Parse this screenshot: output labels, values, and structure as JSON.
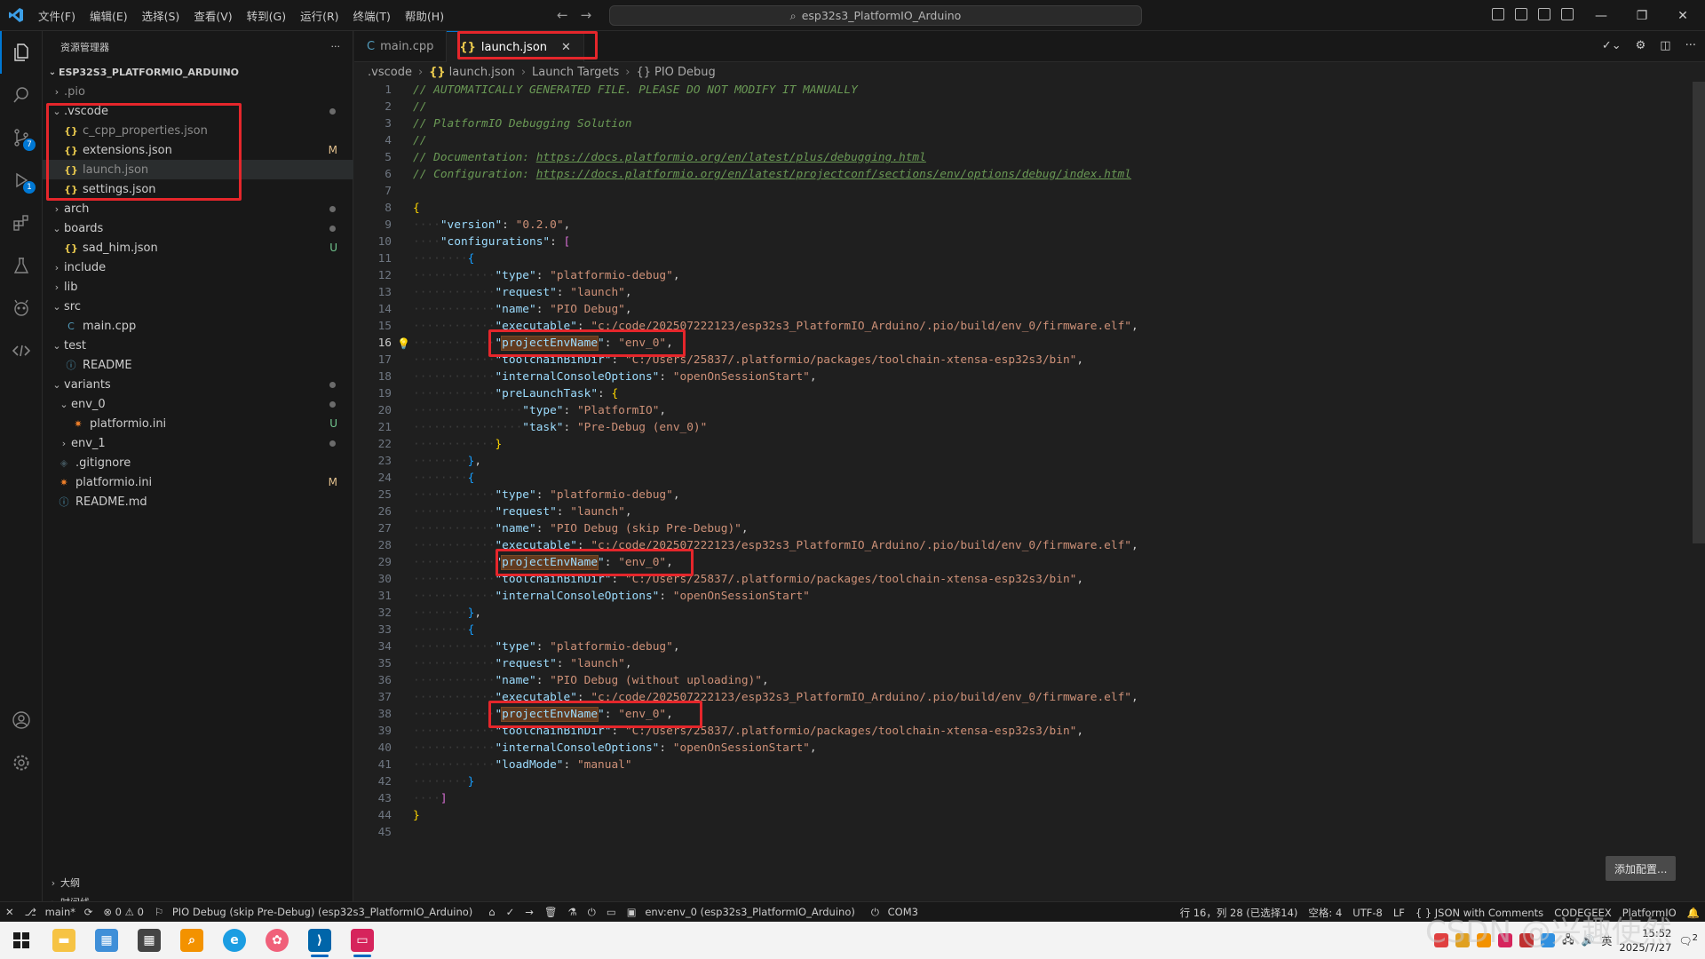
{
  "titlebar": {
    "menu": [
      "文件(F)",
      "编辑(E)",
      "选择(S)",
      "查看(V)",
      "转到(G)",
      "运行(R)",
      "终端(T)",
      "帮助(H)"
    ],
    "search": "esp32s3_PlatformIO_Arduino"
  },
  "activitybar": {
    "scm_badge": "7",
    "debug_badge": "1"
  },
  "sidebar": {
    "title": "资源管理器",
    "project": "ESP32S3_PLATFORMIO_ARDUINO",
    "tree": [
      {
        "label": ".pio",
        "depth": 0,
        "kind": "folder",
        "open": false,
        "dim": true,
        "status": ""
      },
      {
        "label": ".vscode",
        "depth": 0,
        "kind": "folder",
        "open": true,
        "dim": false,
        "status": "dot"
      },
      {
        "label": "c_cpp_properties.json",
        "depth": 1,
        "kind": "json",
        "dim": true,
        "status": ""
      },
      {
        "label": "extensions.json",
        "depth": 1,
        "kind": "json",
        "dim": false,
        "status": "M"
      },
      {
        "label": "launch.json",
        "depth": 1,
        "kind": "json",
        "dim": true,
        "status": "",
        "selected": true
      },
      {
        "label": "settings.json",
        "depth": 1,
        "kind": "json",
        "dim": false,
        "status": ""
      },
      {
        "label": "arch",
        "depth": 0,
        "kind": "folder",
        "open": false,
        "dim": false,
        "status": "dot"
      },
      {
        "label": "boards",
        "depth": 0,
        "kind": "folder",
        "open": true,
        "dim": false,
        "status": "dot"
      },
      {
        "label": "sad_him.json",
        "depth": 1,
        "kind": "json",
        "dim": false,
        "status": "U"
      },
      {
        "label": "include",
        "depth": 0,
        "kind": "folder",
        "open": false,
        "dim": false,
        "status": ""
      },
      {
        "label": "lib",
        "depth": 0,
        "kind": "folder",
        "open": false,
        "dim": false,
        "status": ""
      },
      {
        "label": "src",
        "depth": 0,
        "kind": "folder",
        "open": true,
        "dim": false,
        "status": ""
      },
      {
        "label": "main.cpp",
        "depth": 1,
        "kind": "cpp",
        "dim": false,
        "status": ""
      },
      {
        "label": "test",
        "depth": 0,
        "kind": "folder",
        "open": true,
        "dim": false,
        "status": ""
      },
      {
        "label": "README",
        "depth": 1,
        "kind": "info",
        "dim": false,
        "status": ""
      },
      {
        "label": "variants",
        "depth": 0,
        "kind": "folder",
        "open": true,
        "dim": false,
        "status": "dot"
      },
      {
        "label": "env_0",
        "depth": 1,
        "kind": "folder",
        "open": true,
        "dim": false,
        "status": "dot"
      },
      {
        "label": "platformio.ini",
        "depth": 2,
        "kind": "pio",
        "dim": false,
        "status": "U"
      },
      {
        "label": "env_1",
        "depth": 1,
        "kind": "folder",
        "open": false,
        "dim": false,
        "status": "dot"
      },
      {
        "label": ".gitignore",
        "depth": 0,
        "kind": "git",
        "dim": false,
        "status": ""
      },
      {
        "label": "platformio.ini",
        "depth": 0,
        "kind": "pio",
        "dim": false,
        "status": "M"
      },
      {
        "label": "README.md",
        "depth": 0,
        "kind": "info",
        "dim": false,
        "status": ""
      }
    ],
    "outline": [
      "大纲",
      "时间线"
    ]
  },
  "tabs": [
    {
      "label": "main.cpp",
      "kind": "cpp",
      "active": false
    },
    {
      "label": "launch.json",
      "kind": "json",
      "active": true
    }
  ],
  "breadcrumb": [
    ".vscode",
    "launch.json",
    "Launch Targets",
    "PIO Debug"
  ],
  "code": {
    "current_line": 16,
    "bulb_line": 16,
    "lines": [
      "// AUTOMATICALLY GENERATED FILE. PLEASE DO NOT MODIFY IT MANUALLY",
      "//",
      "// PlatformIO Debugging Solution",
      "//",
      "// Documentation: https://docs.platformio.org/en/latest/plus/debugging.html",
      "// Configuration: https://docs.platformio.org/en/latest/projectconf/sections/env/options/debug/index.html",
      "",
      "{",
      "    \"version\": \"0.2.0\",",
      "    \"configurations\": [",
      "        {",
      "            \"type\": \"platformio-debug\",",
      "            \"request\": \"launch\",",
      "            \"name\": \"PIO Debug\",",
      "            \"executable\": \"c:/code/202507222123/esp32s3_PlatformIO_Arduino/.pio/build/env_0/firmware.elf\",",
      "            \"projectEnvName\": \"env_0\",",
      "            \"toolchainBinDir\": \"C:/Users/25837/.platformio/packages/toolchain-xtensa-esp32s3/bin\",",
      "            \"internalConsoleOptions\": \"openOnSessionStart\",",
      "            \"preLaunchTask\": {",
      "                \"type\": \"PlatformIO\",",
      "                \"task\": \"Pre-Debug (env_0)\"",
      "            }",
      "        },",
      "        {",
      "            \"type\": \"platformio-debug\",",
      "            \"request\": \"launch\",",
      "            \"name\": \"PIO Debug (skip Pre-Debug)\",",
      "            \"executable\": \"c:/code/202507222123/esp32s3_PlatformIO_Arduino/.pio/build/env_0/firmware.elf\",",
      "            \"projectEnvName\": \"env_0\",",
      "            \"toolchainBinDir\": \"C:/Users/25837/.platformio/packages/toolchain-xtensa-esp32s3/bin\",",
      "            \"internalConsoleOptions\": \"openOnSessionStart\"",
      "        },",
      "        {",
      "            \"type\": \"platformio-debug\",",
      "            \"request\": \"launch\",",
      "            \"name\": \"PIO Debug (without uploading)\",",
      "            \"executable\": \"c:/code/202507222123/esp32s3_PlatformIO_Arduino/.pio/build/env_0/firmware.elf\",",
      "            \"projectEnvName\": \"env_0\",",
      "            \"toolchainBinDir\": \"C:/Users/25837/.platformio/packages/toolchain-xtensa-esp32s3/bin\",",
      "            \"internalConsoleOptions\": \"openOnSessionStart\",",
      "            \"loadMode\": \"manual\"",
      "        }",
      "    ]",
      "}",
      ""
    ]
  },
  "add_config_button": "添加配置...",
  "statusbar": {
    "left": [
      "main*",
      "⊗ 0 ⚠ 0",
      "PIO Debug (skip Pre-Debug) (esp32s3_PlatformIO_Arduino)",
      "env:env_0 (esp32s3_PlatformIO_Arduino)",
      "COM3"
    ],
    "right": [
      "行 16，列 28 (已选择14)",
      "空格: 4",
      "UTF-8",
      "LF",
      "{ } JSON with Comments",
      "CODEGEEX",
      "PlatformIO"
    ]
  },
  "taskbar": {
    "time": "15:52",
    "date": "2025/7/27",
    "ime": "英",
    "notif": "2"
  },
  "watermark": "CSDN @兴趣使然",
  "colors": {
    "accent": "#0078d4",
    "annotation": "#e5262b",
    "editor_bg": "#1f1f1f",
    "sidebar_bg": "#181818"
  }
}
